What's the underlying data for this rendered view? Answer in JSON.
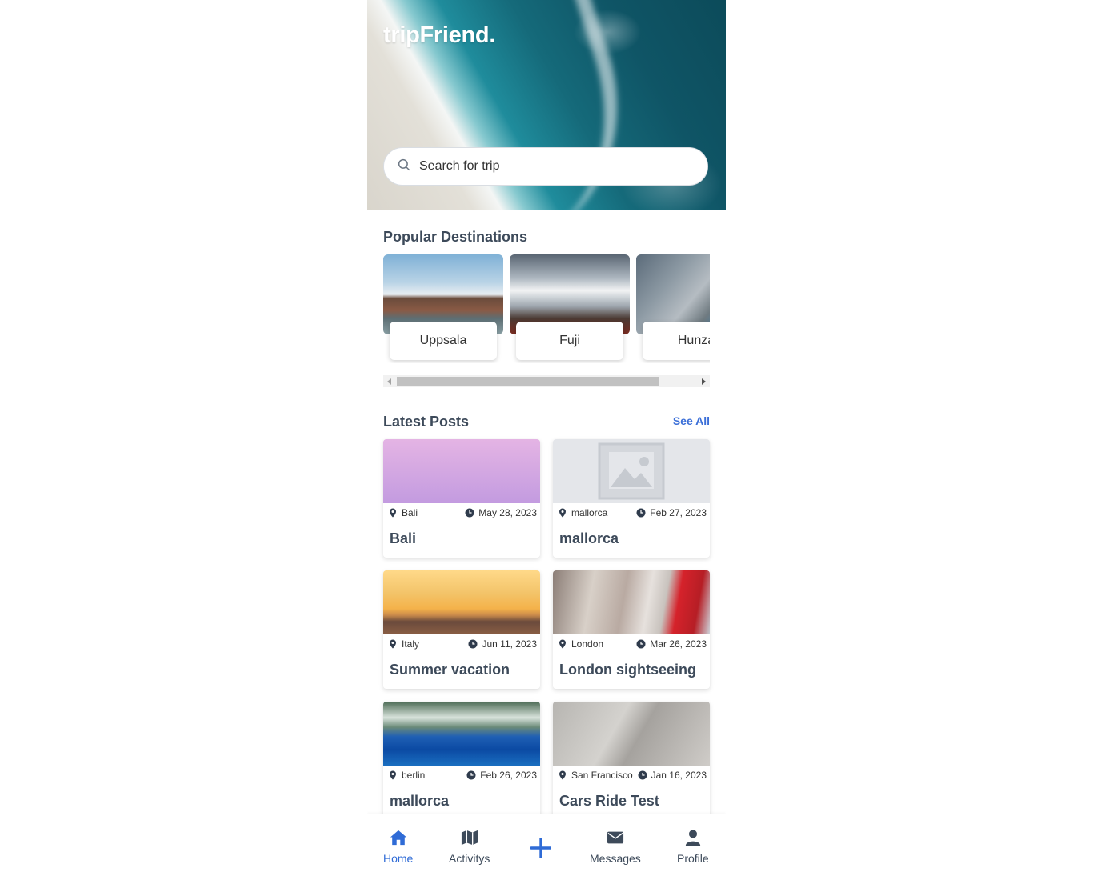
{
  "brand": "tripFriend.",
  "search": {
    "placeholder": "Search for trip"
  },
  "popular": {
    "title": "Popular Destinations",
    "items": [
      {
        "label": "Uppsala"
      },
      {
        "label": "Fuji"
      },
      {
        "label": "Hunza"
      }
    ]
  },
  "latest": {
    "title": "Latest Posts",
    "see_all": "See All",
    "posts": [
      {
        "location": "Bali",
        "date": "May 28, 2023",
        "title": "Bali"
      },
      {
        "location": "mallorca",
        "date": "Feb 27, 2023",
        "title": "mallorca"
      },
      {
        "location": "Italy",
        "date": "Jun 11, 2023",
        "title": "Summer vacation"
      },
      {
        "location": "London",
        "date": "Mar 26, 2023",
        "title": "London sightseeing"
      },
      {
        "location": "berlin",
        "date": "Feb 26, 2023",
        "title": "mallorca"
      },
      {
        "location": "San Francisco",
        "date": "Jan 16, 2023",
        "title": "Cars Ride Test"
      }
    ]
  },
  "nav": {
    "home": "Home",
    "activities": "Activitys",
    "messages": "Messages",
    "profile": "Profile"
  },
  "colors": {
    "accent": "#2f6bd6",
    "text": "#3d4a5a"
  },
  "icons": [
    "search-icon",
    "location-pin-icon",
    "clock-icon",
    "home-icon",
    "map-icon",
    "plus-icon",
    "envelope-icon",
    "user-icon",
    "image-placeholder-icon"
  ]
}
